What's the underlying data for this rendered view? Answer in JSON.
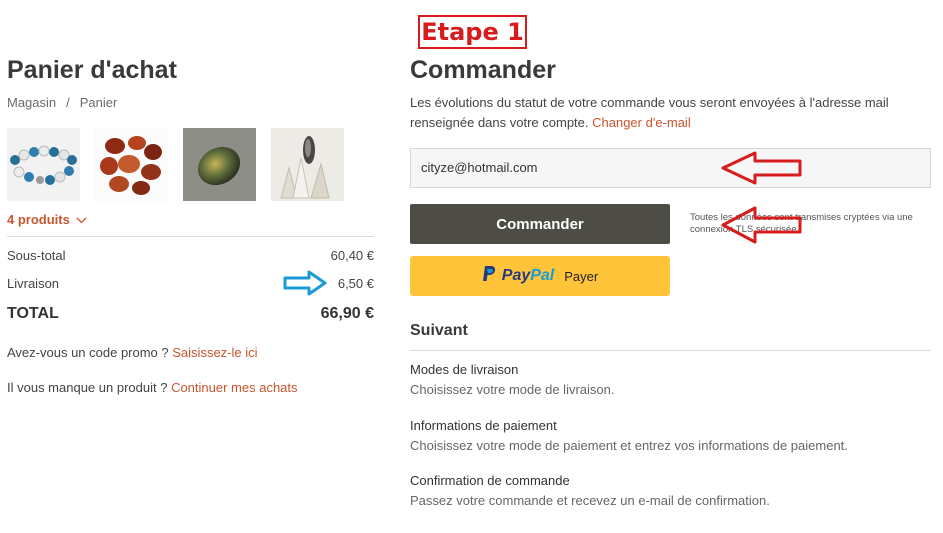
{
  "annotation": {
    "step_label": "Etape 1"
  },
  "cart": {
    "title": "Panier d'achat",
    "breadcrumb": [
      "Magasin",
      "/",
      "Panier"
    ],
    "product_count": "4 produits",
    "rows": [
      {
        "label": "Sous-total",
        "value": "60,40 €"
      },
      {
        "label": "Livraison",
        "value": "6,50 €"
      }
    ],
    "total": {
      "label": "TOTAL",
      "value": "66,90 €"
    },
    "promo": {
      "text": "Avez-vous un code promo ?",
      "link": "Saisissez-le ici"
    },
    "missing": {
      "text": "Il vous manque un produit ?",
      "link": "Continuer mes achats"
    }
  },
  "checkout": {
    "title": "Commander",
    "info_text": "Les évolutions du statut de votre commande vous seront envoyées à l'adresse mail renseignée dans votre compte.",
    "change_email_link": "Changer d'e-mail",
    "email_value": "cityze@hotmail.com",
    "order_button": "Commander",
    "secure_note": "Toutes les données sont transmises cryptées via une connexion TLS sécurisée.",
    "paypal": {
      "pay": "Pay",
      "pal": "Pal",
      "label": "Payer"
    }
  },
  "next": {
    "title": "Suivant",
    "steps": [
      {
        "title": "Modes de livraison",
        "desc": "Choisissez votre mode de livraison."
      },
      {
        "title": "Informations de paiement",
        "desc": "Choisissez votre mode de paiement et entrez vos informations de paiement."
      },
      {
        "title": "Confirmation de commande",
        "desc": "Passez votre commande et recevez un e-mail de confirmation."
      }
    ]
  },
  "colors": {
    "accent": "#c8552d",
    "annotation_red": "#d61c1c",
    "annotation_blue": "#1a9bd7",
    "paypal_yellow": "#ffc43a",
    "button_dark": "#4d4d45"
  },
  "icons": [
    "chevron-down-icon",
    "paypal-logo-icon",
    "red-arrow-icon",
    "blue-arrow-icon"
  ]
}
